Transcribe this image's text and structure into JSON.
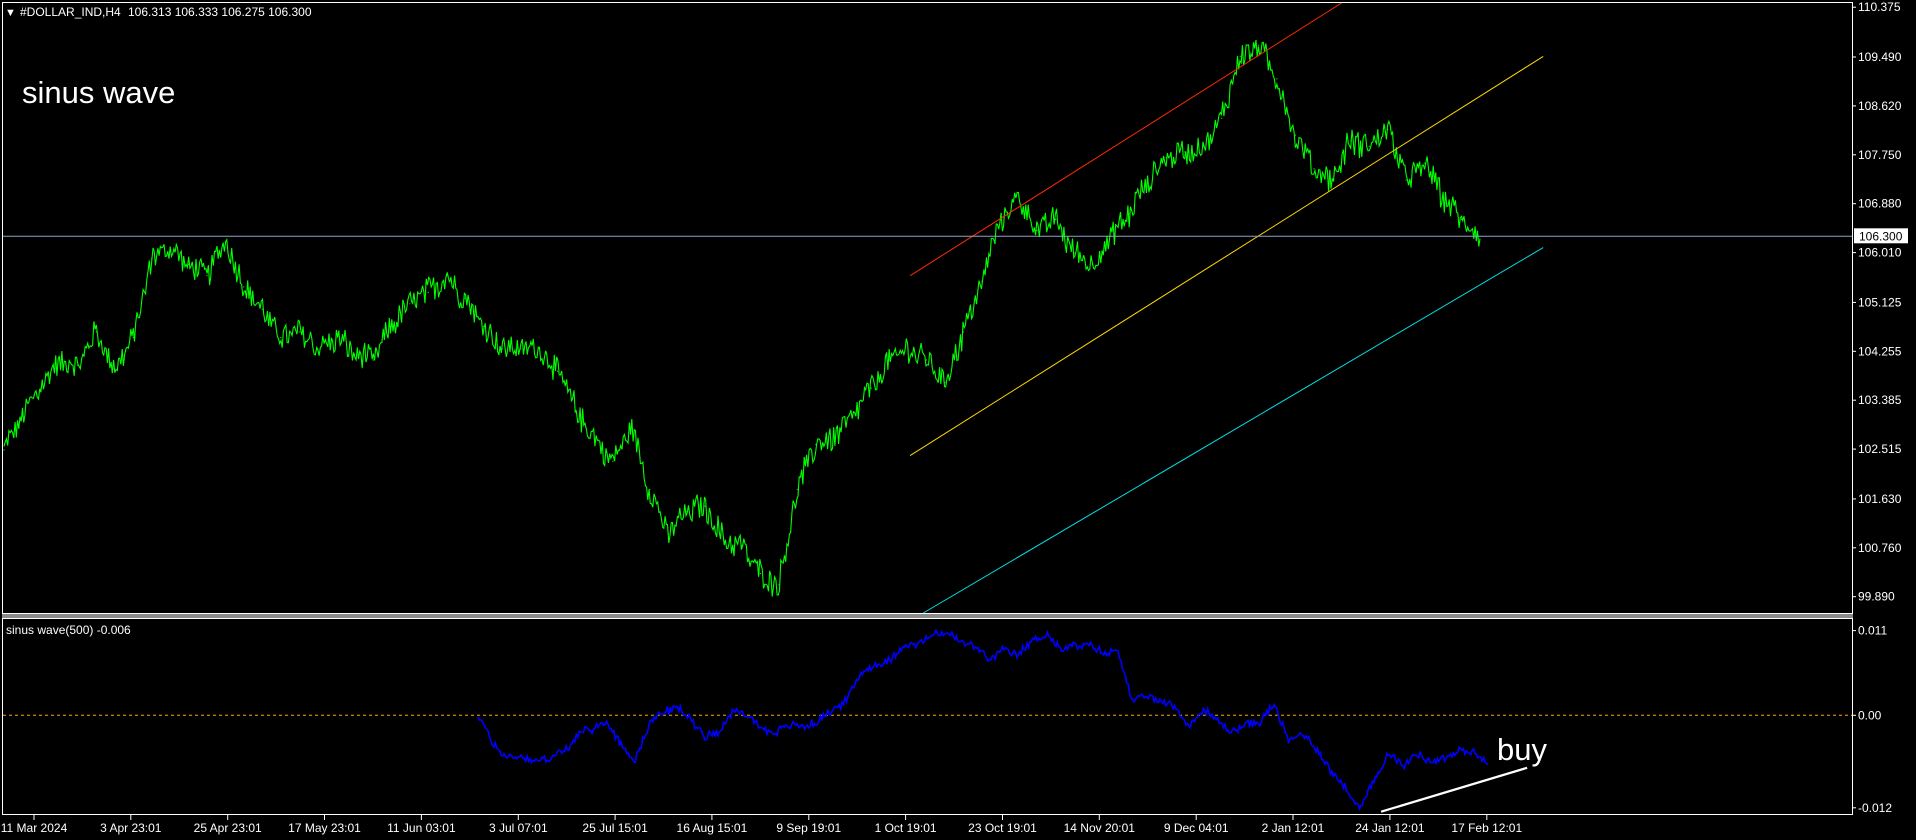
{
  "header": {
    "collapse_glyph": "▼",
    "symbol": "#DOLLAR_IND,H4",
    "ohlc": "106.313 106.333 106.275 106.300"
  },
  "annotation_main": "sinus wave",
  "annotation_signal": "buy",
  "indicator": {
    "label": "sinus wave(500) -0.006"
  },
  "colors": {
    "background": "#000000",
    "price": "#00ff00",
    "indicator": "#0000ff",
    "channel_upper": "#ff2a00",
    "channel_middle": "#ffd700",
    "channel_lower": "#00dfe8",
    "hline": "#8fa0c8",
    "zero_line": "#ffa500",
    "trend_line": "#ffffff",
    "frame": "#ffffff",
    "separator": "#808080"
  },
  "chart_data": [
    {
      "type": "line",
      "panel": "price",
      "symbol": "#DOLLAR_IND",
      "timeframe": "H4",
      "ylim": [
        99.6,
        110.45
      ],
      "y_ticks": [
        "110.375",
        "109.490",
        "108.620",
        "107.750",
        "106.880",
        "106.010",
        "105.125",
        "104.255",
        "103.385",
        "102.515",
        "101.630",
        "100.760",
        "99.890"
      ],
      "current_price": 106.3,
      "current_price_label": "106.300",
      "x_tick_labels": [
        "11 Mar 2024",
        "3 Apr 23:01",
        "25 Apr 23:01",
        "17 May 23:01",
        "11 Jun 03:01",
        "3 Jul 07:01",
        "25 Jul 15:01",
        "16 Aug 15:01",
        "9 Sep 19:01",
        "1 Oct 19:01",
        "23 Oct 19:01",
        "14 Nov 20:01",
        "9 Dec 04:01",
        "2 Jan 12:01",
        "24 Jan 12:01",
        "17 Feb 12:01"
      ],
      "series": [
        {
          "values": [
            102.5,
            103.1,
            103.6,
            104.1,
            104.0,
            104.6,
            103.9,
            104.5,
            105.9,
            106.1,
            105.8,
            105.6,
            106.2,
            105.4,
            105.0,
            104.5,
            104.6,
            104.3,
            104.5,
            104.2,
            104.1,
            104.7,
            105.1,
            105.3,
            105.6,
            105.2,
            104.7,
            104.3,
            104.3,
            104.3,
            103.9,
            103.2,
            102.7,
            102.3,
            102.9,
            101.8,
            101.0,
            101.4,
            101.5,
            100.9,
            100.8,
            100.3,
            100.1,
            101.8,
            102.6,
            102.7,
            103.1,
            103.6,
            104.1,
            104.3,
            104.1,
            103.7,
            104.6,
            105.5,
            106.6,
            107.0,
            106.4,
            106.6,
            106.0,
            105.8,
            106.3,
            106.7,
            107.3,
            107.7,
            107.8,
            107.9,
            108.4,
            109.5,
            109.7,
            109.1,
            108.1,
            107.5,
            107.3,
            108.0,
            107.9,
            108.2,
            107.3,
            107.6,
            107.0,
            106.6,
            106.3
          ]
        }
      ],
      "channel_lines": [
        {
          "name": "upper",
          "from": [
            "2 Oct 2024",
            105.6
          ],
          "to": [
            "13 Jan 2025",
            110.45
          ]
        },
        {
          "name": "middle",
          "from": [
            "2 Oct 2024",
            102.4
          ],
          "to": [
            "3 Mar 2025",
            109.5
          ]
        },
        {
          "name": "lower",
          "from": [
            "5 Oct 2024",
            99.6
          ],
          "to": [
            "3 Mar 2025",
            106.1
          ]
        }
      ]
    },
    {
      "type": "line",
      "panel": "indicator",
      "title": "sinus wave(500) -0.006",
      "ylim": [
        -0.0128,
        0.0125
      ],
      "y_ticks": [
        "0.011",
        "0.00",
        "-0.012"
      ],
      "levels": [
        0.0
      ],
      "current_value": -0.006,
      "series": [
        {
          "name": "sinus wave(500)",
          "values": [
            0.0,
            -0.0035,
            -0.0055,
            -0.0052,
            -0.006,
            -0.0055,
            -0.0048,
            -0.0025,
            -0.0018,
            -0.0008,
            -0.0035,
            -0.006,
            -0.0012,
            0.0005,
            0.001,
            -0.0005,
            -0.0028,
            -0.0018,
            0.0005,
            0.0,
            -0.0018,
            -0.0022,
            -0.0012,
            -0.0015,
            -0.0005,
            0.0008,
            0.0022,
            0.0058,
            0.0065,
            0.0072,
            0.0092,
            0.0092,
            0.0105,
            0.0107,
            0.0095,
            0.0088,
            0.0072,
            0.0085,
            0.0078,
            0.0098,
            0.0105,
            0.0085,
            0.009,
            0.0092,
            0.008,
            0.0085,
            0.0018,
            0.0025,
            0.0018,
            0.0012,
            -0.0015,
            0.0008,
            -0.0008,
            -0.0022,
            -0.0012,
            -0.0008,
            0.0015,
            -0.0035,
            -0.0022,
            -0.0045,
            -0.0072,
            -0.0095,
            -0.0122,
            -0.0085,
            -0.0048,
            -0.0065,
            -0.005,
            -0.006,
            -0.0055,
            -0.0045,
            -0.0048,
            -0.006
          ]
        }
      ],
      "trend_line": {
        "from": [
          "22 Jan 2025",
          -0.0125
        ],
        "to": [
          "27 Feb 2025",
          -0.0068
        ]
      }
    }
  ]
}
